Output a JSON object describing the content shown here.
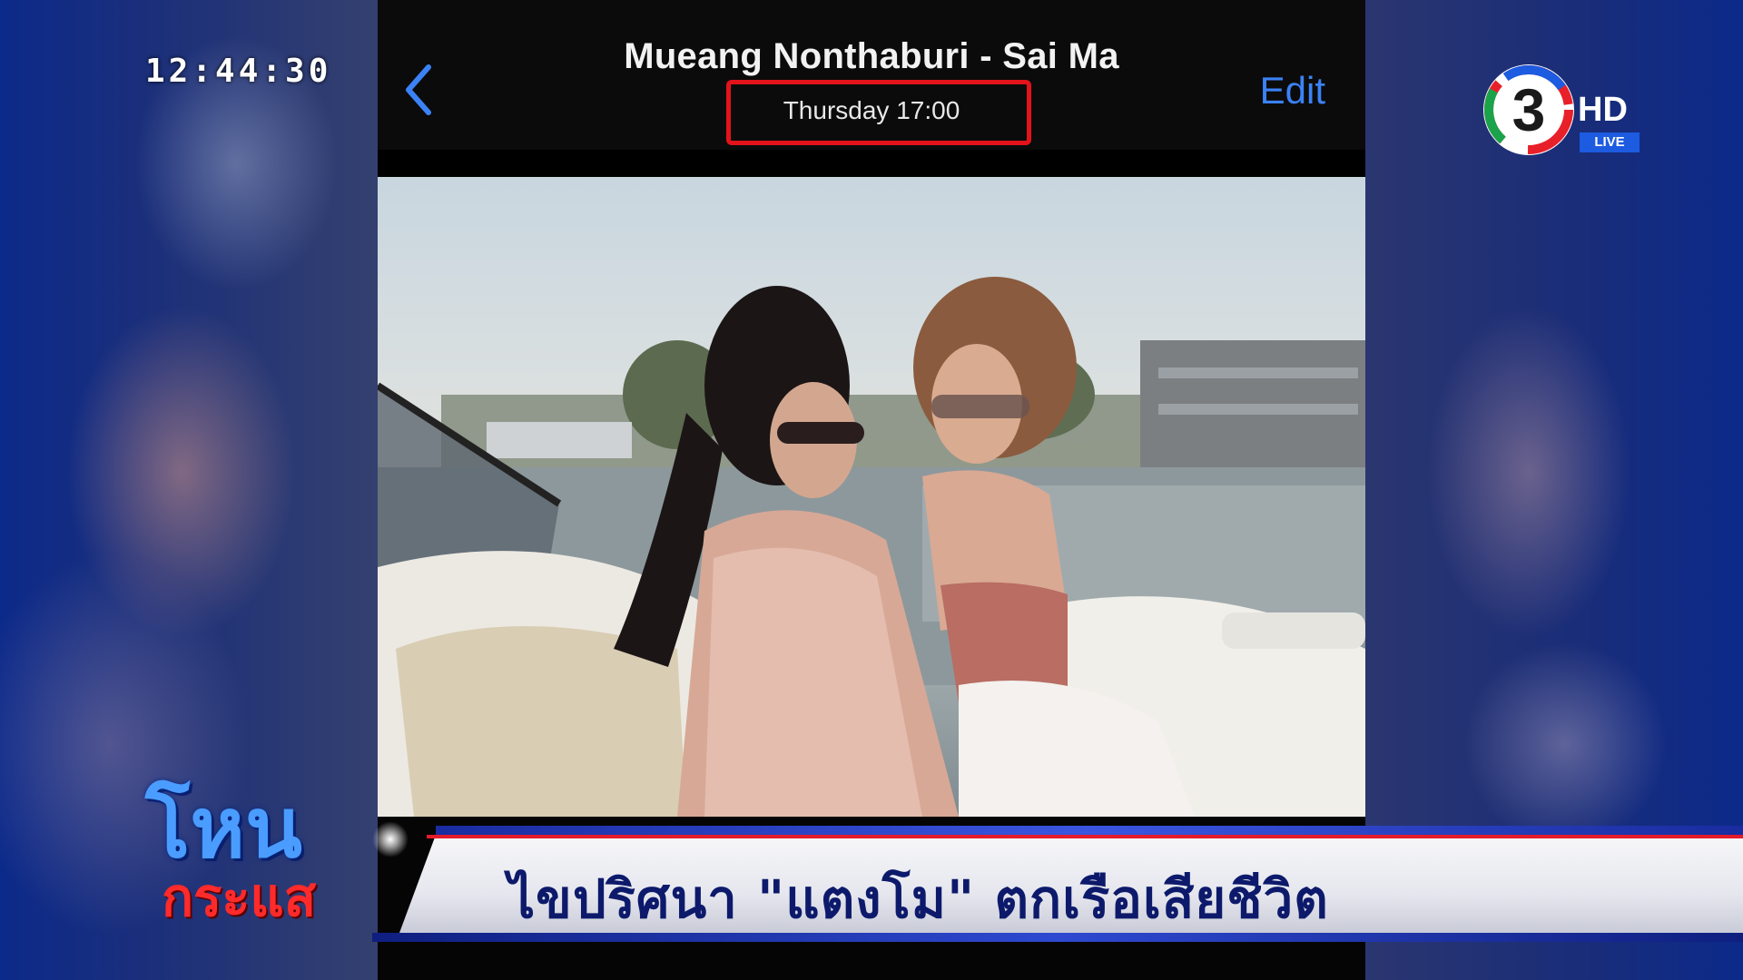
{
  "clock": "12:44:30",
  "photo_app": {
    "title": "Mueang Nonthaburi - Sai Ma",
    "subtitle": "Thursday  17:00",
    "edit_label": "Edit"
  },
  "channel": {
    "number": "3",
    "hd_label": "HD",
    "live_label": "LIVE"
  },
  "show": {
    "title_top": "โหน",
    "title_bottom": "กระแส"
  },
  "headline": "ไขปริศนา \"แตงโม\" ตกเรือเสียชีวิต",
  "colors": {
    "highlight_box": "#e3131b",
    "edit_link": "#3b82f6",
    "headline_text": "#0d1a6b"
  }
}
